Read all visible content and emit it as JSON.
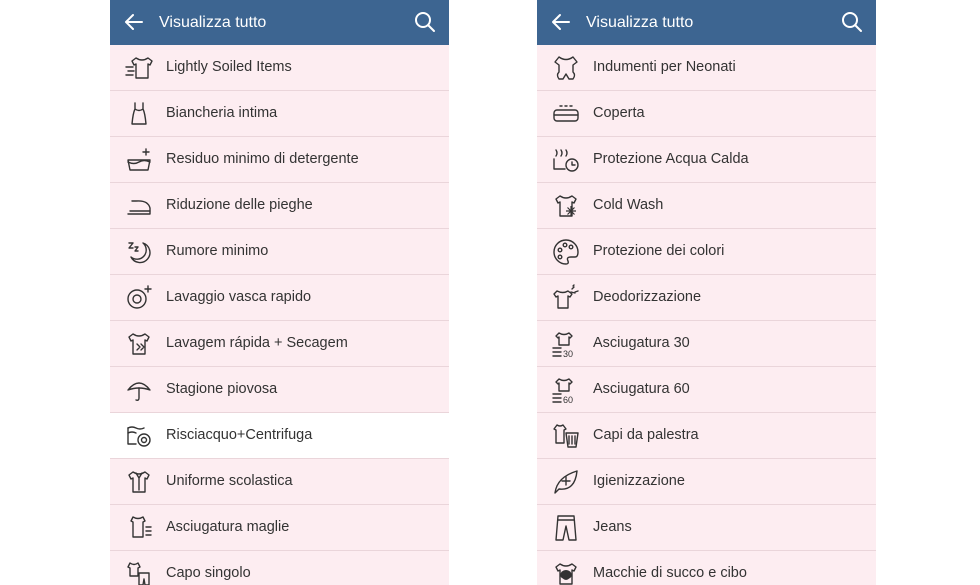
{
  "colors": {
    "header": "#3d6591",
    "row": "#fdedf1",
    "selected_row": "#ffffff",
    "text": "#333333"
  },
  "left": {
    "header": {
      "title": "Visualizza tutto",
      "back_icon": "arrow-left-icon",
      "search_icon": "search-icon"
    },
    "items": [
      {
        "label": "Lightly Soiled Items",
        "icon": "shirt-fast-icon"
      },
      {
        "label": "Biancheria intima",
        "icon": "underwear-icon"
      },
      {
        "label": "Residuo minimo di detergente",
        "icon": "basin-sparkle-icon"
      },
      {
        "label": "Riduzione delle pieghe",
        "icon": "iron-icon"
      },
      {
        "label": "Rumore minimo",
        "icon": "moon-zz-icon"
      },
      {
        "label": "Lavaggio vasca rapido",
        "icon": "tub-clean-icon"
      },
      {
        "label": "Lavagem rápida + Secagem",
        "icon": "shirt-arrows-icon"
      },
      {
        "label": "Stagione piovosa",
        "icon": "umbrella-icon"
      },
      {
        "label": "Risciacquo+Centrifuga",
        "icon": "rinse-spin-icon",
        "selected": true
      },
      {
        "label": "Uniforme scolastica",
        "icon": "uniform-shirt-icon"
      },
      {
        "label": "Asciugatura maglie",
        "icon": "shirt-dry-icon"
      },
      {
        "label": "Capo singolo",
        "icon": "single-garment-icon"
      }
    ]
  },
  "right": {
    "header": {
      "title": "Visualizza tutto",
      "back_icon": "arrow-left-icon",
      "search_icon": "search-icon"
    },
    "items": [
      {
        "label": "Indumenti per Neonati",
        "icon": "baby-clothes-icon"
      },
      {
        "label": "Coperta",
        "icon": "blanket-icon"
      },
      {
        "label": "Protezione Acqua Calda",
        "icon": "hot-water-icon"
      },
      {
        "label": "Cold Wash",
        "icon": "shirt-snowflake-icon"
      },
      {
        "label": "Protezione dei colori",
        "icon": "palette-icon"
      },
      {
        "label": "Deodorizzazione",
        "icon": "shirt-spray-icon"
      },
      {
        "label": "Asciugatura 30",
        "icon": "dry-30-icon",
        "badge": "30"
      },
      {
        "label": "Asciugatura 60",
        "icon": "dry-60-icon",
        "badge": "60"
      },
      {
        "label": "Capi da palestra",
        "icon": "gym-clothes-icon"
      },
      {
        "label": "Igienizzazione",
        "icon": "leaf-plus-icon"
      },
      {
        "label": "Jeans",
        "icon": "jeans-icon"
      },
      {
        "label": "Macchie di succo e cibo",
        "icon": "stain-shirt-icon"
      }
    ]
  }
}
